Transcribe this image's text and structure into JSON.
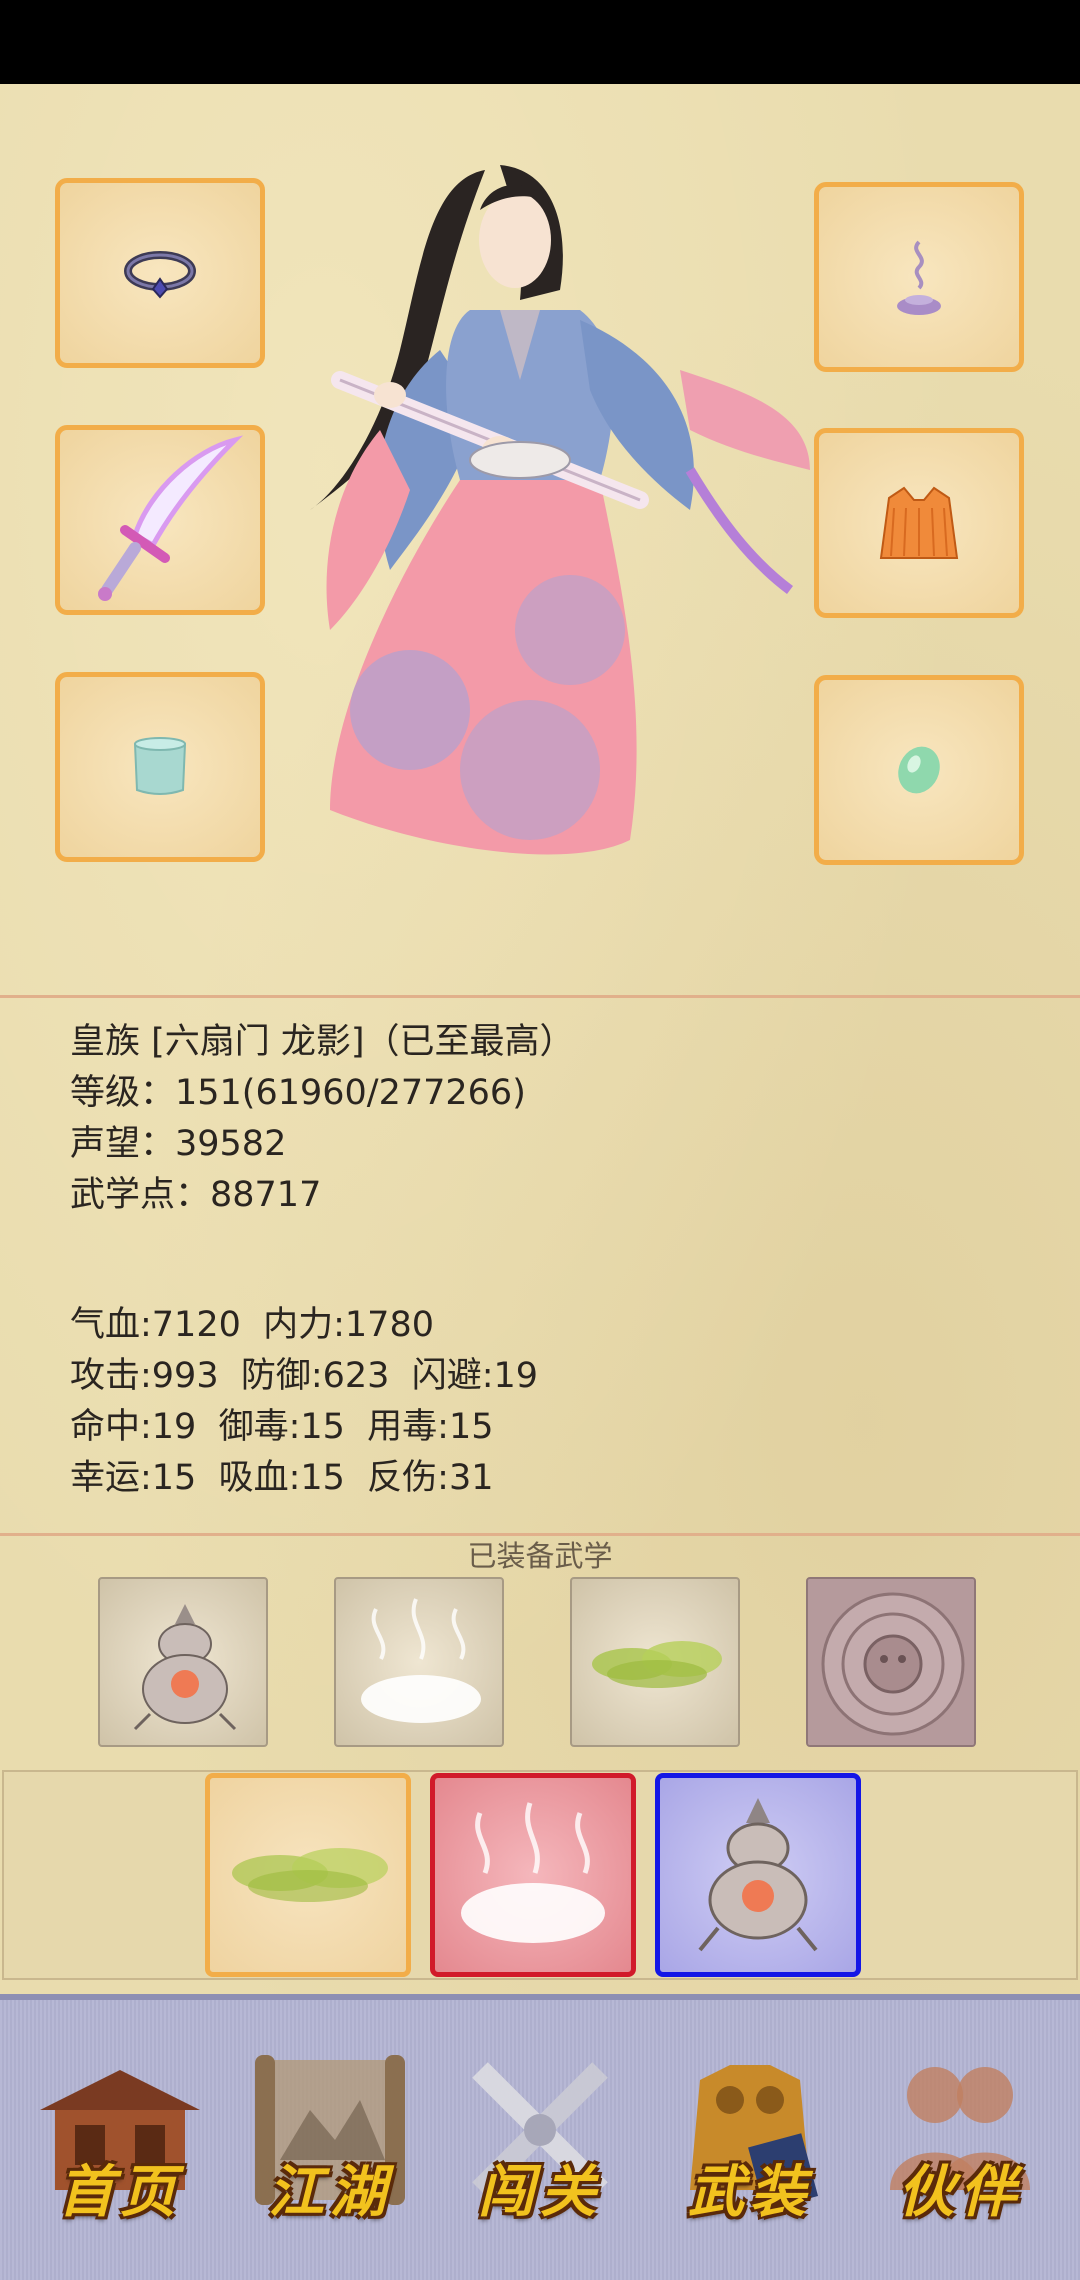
{
  "equipment": {
    "slots": [
      {
        "name": "ring",
        "icon": "ring-icon"
      },
      {
        "name": "incense",
        "icon": "incense-icon"
      },
      {
        "name": "sword",
        "icon": "sword-icon"
      },
      {
        "name": "armor",
        "icon": "armor-icon"
      },
      {
        "name": "bracer",
        "icon": "bracer-icon"
      },
      {
        "name": "jade",
        "icon": "jade-icon"
      }
    ]
  },
  "character": {
    "title_line": "皇族 [六扇门 龙影]（已至最高）",
    "level_line": "等级：151(61960/277266)",
    "reputation_line": "声望：39582",
    "martial_points_line": "武学点：88717"
  },
  "stats": {
    "line1": "气血:7120  内力:1780",
    "line2": "攻击:993  防御:623  闪避:19",
    "line3": "命中:19  御毒:15  用毒:15",
    "line4": "幸运:15  吸血:15  反伤:31"
  },
  "equipped_skills_label": "已装备武学",
  "skills": [
    "gourd-skill-icon",
    "mist-skill-icon",
    "green-cloud-skill-icon",
    "aztec-seal-skill-icon"
  ],
  "active_slots": [
    {
      "icon": "green-cloud-skill-icon",
      "border": "#f2ad49",
      "bg": "#f5dcab"
    },
    {
      "icon": "mist-skill-icon",
      "border": "#d11a2a",
      "bg": "#ee9aa0"
    },
    {
      "icon": "gourd-skill-icon",
      "border": "#1416e6",
      "bg": "#b8b6ec"
    }
  ],
  "nav": {
    "home": "首页",
    "jianghu": "江湖",
    "chuangguan": "闯关",
    "wuzhuang": "武装",
    "huoban": "伙伴"
  },
  "colors": {
    "parchment": "#e9dcae",
    "slot_border": "#f2ad49",
    "nav_gold": "#f2c21e"
  }
}
